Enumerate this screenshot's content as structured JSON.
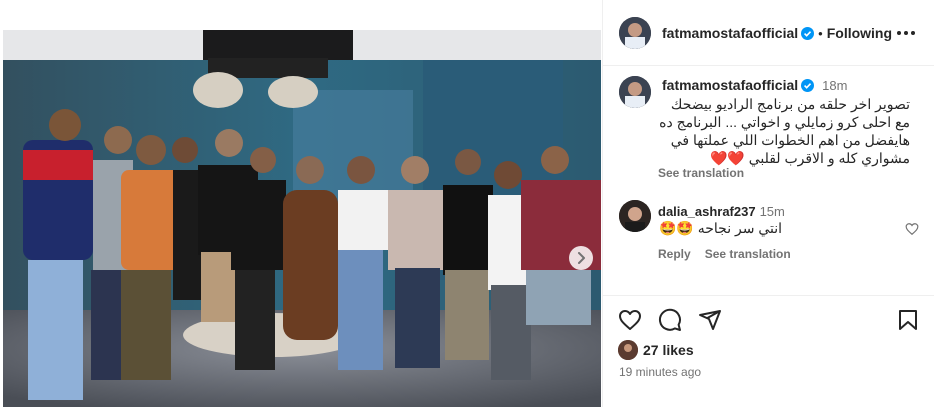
{
  "post": {
    "username": "fatmamostafaofficial",
    "follow_status": "Following",
    "caption_time": "18m",
    "caption": "تصوير اخر حلقه من برنامج الراديو بيضحك مع احلى كرو زمايلي و اخواتي ... البرنامج ده هايفضل من اهم الخطوات اللي عملتها في مشواري كله و الاقرب لقلبي ❤️❤️",
    "see_translation": "See translation"
  },
  "comment": {
    "username": "dalia_ashraf237",
    "time": "15m",
    "text": "انتي سر نجاحه 🤩🤩",
    "reply": "Reply",
    "see_translation": "See translation"
  },
  "engagement": {
    "likes": "27 likes",
    "posted_ago": "19 minutes ago"
  },
  "icons": [
    "more-icon",
    "verified-icon",
    "heart-icon",
    "comment-icon",
    "share-icon",
    "bookmark-icon",
    "chevron-right-icon"
  ],
  "colors": {
    "verified": "#0095f6",
    "text": "#262626",
    "muted": "#737373",
    "border": "#efefef"
  }
}
